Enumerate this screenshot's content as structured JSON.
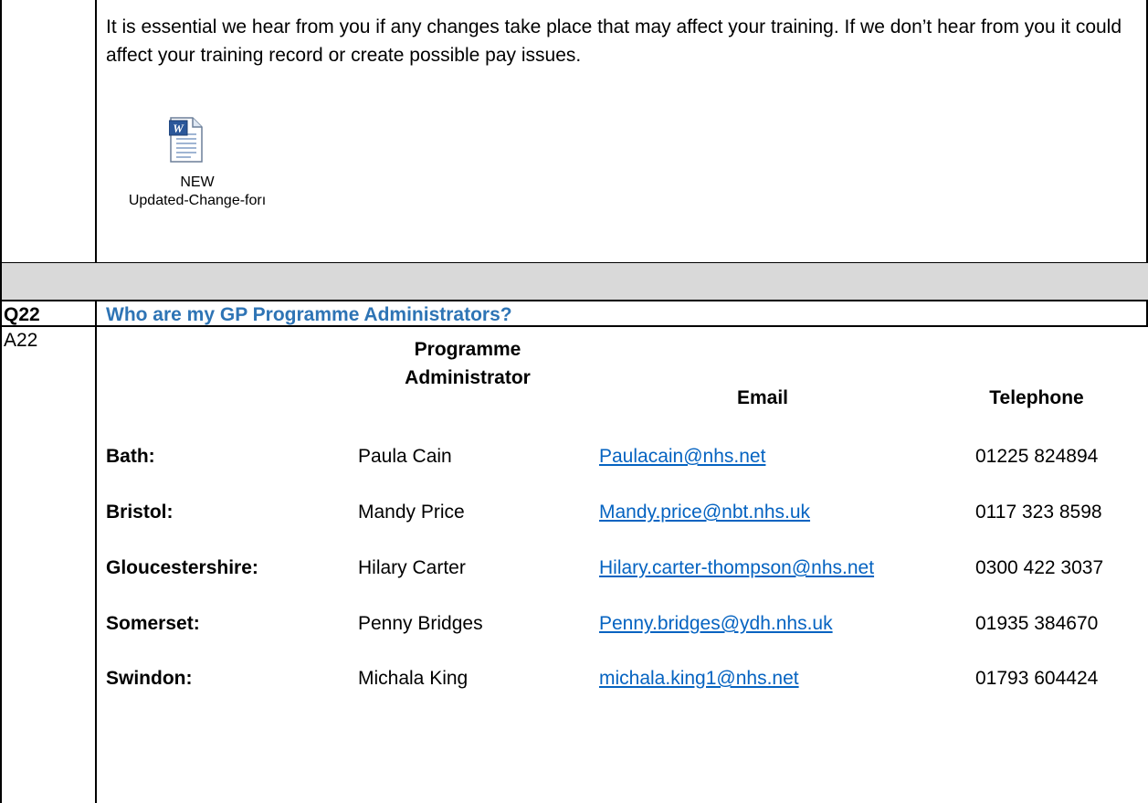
{
  "intro": {
    "text": "It is essential we hear from you if any changes take place that may affect your training.  If we don’t hear from you it could affect your training record or create possible pay issues."
  },
  "attachment": {
    "icon": "word-document-icon",
    "caption_line1": "NEW",
    "caption_line2": "Updated-Change-forı"
  },
  "question": {
    "label": "Q22",
    "text": "Who are my GP Programme Administrators?"
  },
  "answer": {
    "label": "A22",
    "headers": {
      "admin_line1": "Programme",
      "admin_line2": "Administrator",
      "email": "Email",
      "phone": "Telephone"
    },
    "rows": [
      {
        "region": "Bath:",
        "admin": "Paula Cain",
        "email": "Paulacain@nhs.net",
        "phone": "01225 824894"
      },
      {
        "region": "Bristol:",
        "admin": "Mandy Price",
        "email": "Mandy.price@nbt.nhs.uk",
        "phone": "0117 323 8598"
      },
      {
        "region": "Gloucestershire:",
        "admin": "Hilary Carter",
        "email": "Hilary.carter-thompson@nhs.net",
        "phone": "0300 422 3037"
      },
      {
        "region": "Somerset:",
        "admin": "Penny Bridges",
        "email": "Penny.bridges@ydh.nhs.uk",
        "phone": "01935 384670"
      },
      {
        "region": "Swindon:",
        "admin": "Michala King",
        "email": "michala.king1@nhs.net",
        "phone": "01793 604424"
      }
    ]
  },
  "colors": {
    "heading_blue": "#2e74b5",
    "link_blue": "#0563c1",
    "separator_gray": "#d9d9d9"
  }
}
